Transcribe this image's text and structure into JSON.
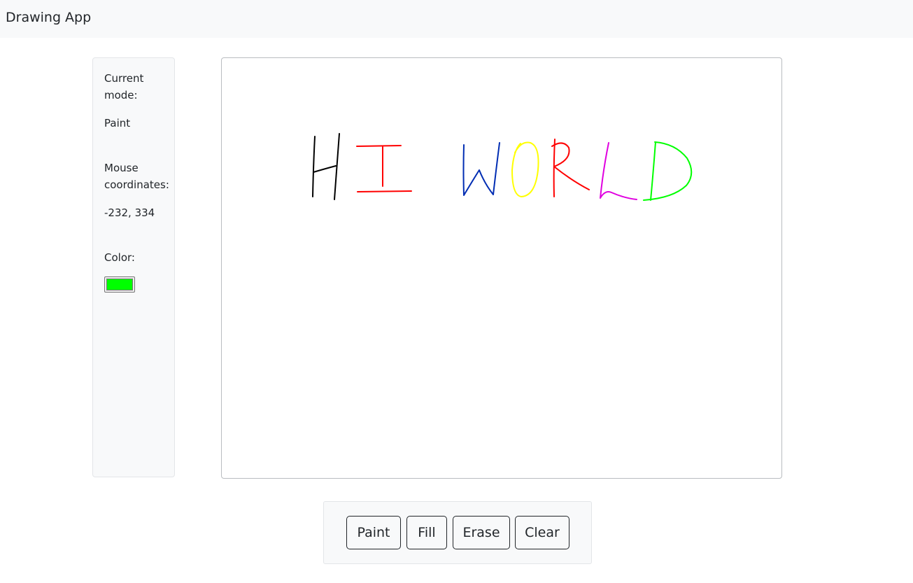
{
  "navbar": {
    "brand": "Drawing App"
  },
  "sidebar": {
    "mode_label": "Current mode:",
    "mode_value": "Paint",
    "mouse_label": "Mouse coordinates:",
    "mouse_value": "-232, 334",
    "color_label": "Color:",
    "color_value": "#00ff00"
  },
  "canvas": {
    "stroke_colors": {
      "h": "#000000",
      "i": "#ff0000",
      "w": "#002db3",
      "o": "#ffff00",
      "r": "#ff0000",
      "l": "#e000e0",
      "d": "#00ff00"
    }
  },
  "toolbar": {
    "paint_label": "Paint",
    "fill_label": "Fill",
    "erase_label": "Erase",
    "clear_label": "Clear"
  }
}
